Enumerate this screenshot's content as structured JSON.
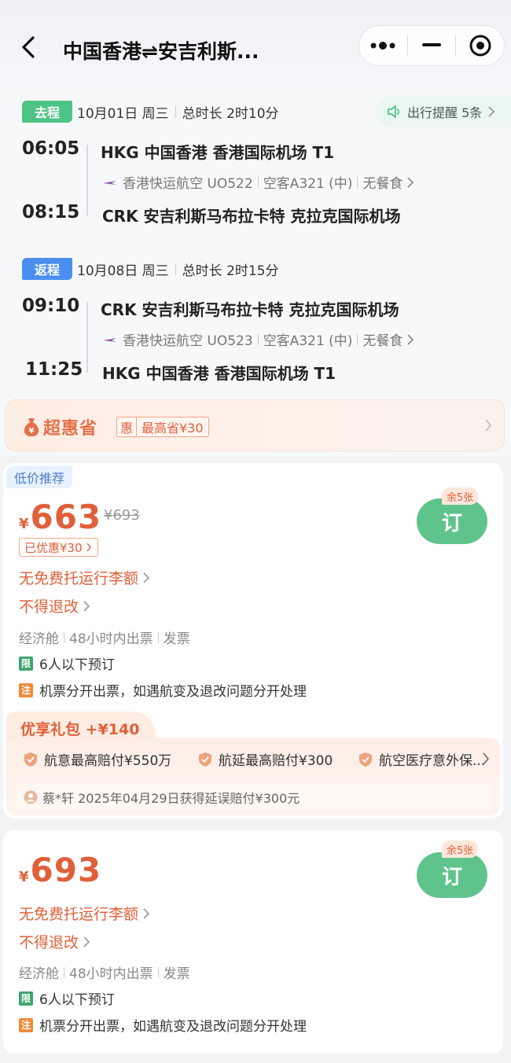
{
  "header": {
    "title": "中国香港⇌安吉利斯...",
    "capsule": {
      "more_icon": "more-dots-icon",
      "minimize_icon": "minimize-icon",
      "close_icon": "target-circle-icon"
    }
  },
  "outbound": {
    "tag": "去程",
    "date": "10月01日 周三",
    "duration": "总时长 2时10分",
    "reminder": "出行提醒 5条",
    "depart_time": "06:05",
    "depart_airport": "HKG 中国香港 香港国际机场 T1",
    "airline": "香港快运航空 UO522",
    "aircraft": "空客A321 (中)",
    "meal": "无餐食",
    "arrive_time": "08:15",
    "arrive_airport": "CRK 安吉利斯马布拉卡特 克拉克国际机场"
  },
  "return": {
    "tag": "返程",
    "date": "10月08日 周三",
    "duration": "总时长 2时15分",
    "depart_time": "09:10",
    "depart_airport": "CRK 安吉利斯马布拉卡特 克拉克国际机场",
    "airline": "香港快运航空 UO523",
    "aircraft": "空客A321 (中)",
    "meal": "无餐食",
    "arrive_time": "11:25",
    "arrive_airport": "HKG 中国香港 香港国际机场 T1"
  },
  "super_saving": {
    "label": "超惠省",
    "badge": "惠",
    "amount": "最高省¥30"
  },
  "products": [
    {
      "rec_tag": "低价推荐",
      "currency": "¥",
      "price": "663",
      "original_price": "¥693",
      "discount": "已优惠¥30",
      "remain": "余5张",
      "book": "订",
      "baggage": "无免费托运行李额",
      "refund": "不得退改",
      "cabin": "经济舱",
      "ticketing": "48小时内出票",
      "invoice": "发票",
      "limit_icon": "限",
      "limit_text": "6人以下预订",
      "note_icon": "注",
      "note_text": "机票分开出票，如遇航变及退改问题分开处理",
      "gift": {
        "title": "优享礼包 +¥140",
        "items": [
          "航意最高赔付¥550万",
          "航延最高赔付¥300",
          "航空医疗意外保..."
        ],
        "claim": "蔡*轩 2025年04月29日获得延误赔付¥300元"
      }
    },
    {
      "currency": "¥",
      "price": "693",
      "remain": "余5张",
      "book": "订",
      "baggage": "无免费托运行李额",
      "refund": "不得退改",
      "cabin": "经济舱",
      "ticketing": "48小时内出票",
      "invoice": "发票",
      "limit_icon": "限",
      "limit_text": "6人以下预订",
      "note_icon": "注",
      "note_text": "机票分开出票，如遇航变及退改问题分开处理"
    }
  ],
  "colors": {
    "accent_orange": "#e0603a",
    "book_green": "#5fc48c",
    "go_green": "#4dc486",
    "return_blue": "#4a8ff0"
  }
}
